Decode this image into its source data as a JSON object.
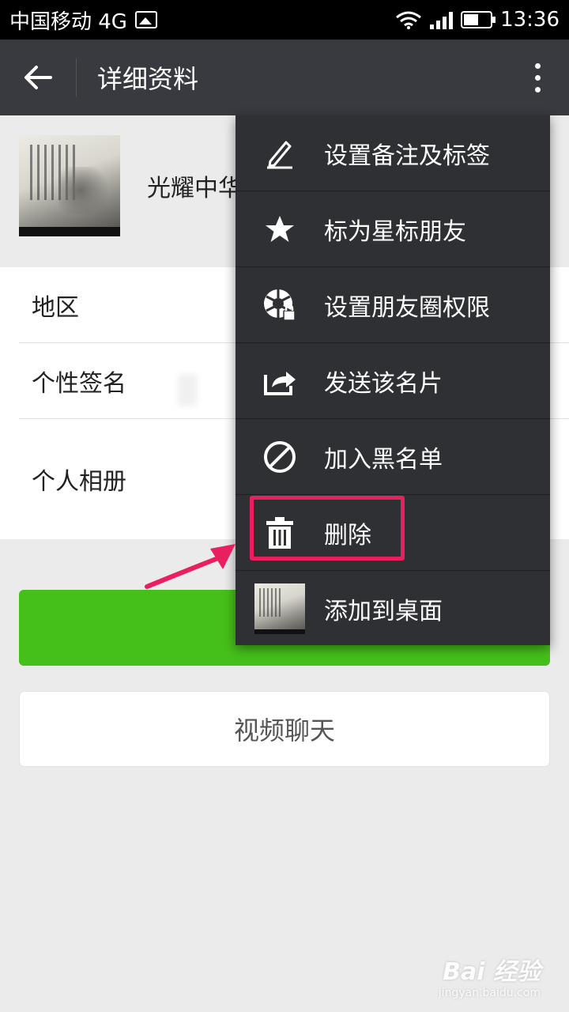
{
  "statusbar": {
    "carrier": "中国移动 4G",
    "time": "13:36",
    "icons": [
      "image-notification-icon",
      "wifi-icon",
      "signal-icon",
      "battery-icon"
    ]
  },
  "appbar": {
    "title": "详细资料",
    "back_icon": "arrow-left-icon",
    "more_icon": "more-vertical-icon"
  },
  "profile": {
    "name": "光耀中华"
  },
  "info": {
    "region_label": "地区",
    "signature_label": "个性签名",
    "album_label": "个人相册"
  },
  "buttons": {
    "video_chat": "视频聊天",
    "primary_color": "#45c01a"
  },
  "menu": {
    "items": [
      {
        "label": "设置备注及标签",
        "icon": "edit-pencil-icon"
      },
      {
        "label": "标为星标朋友",
        "icon": "star-icon"
      },
      {
        "label": "设置朋友圈权限",
        "icon": "moments-lock-icon"
      },
      {
        "label": "发送该名片",
        "icon": "share-icon"
      },
      {
        "label": "加入黑名单",
        "icon": "block-icon"
      },
      {
        "label": "删除",
        "icon": "trash-icon"
      },
      {
        "label": "添加到桌面",
        "icon": "avatar-thumbnail"
      }
    ],
    "highlighted_item": "删除",
    "highlight_color": "#ea1f5f"
  },
  "watermark": {
    "brand": "Bai 经验",
    "url": "jingyan.baidu.com"
  }
}
